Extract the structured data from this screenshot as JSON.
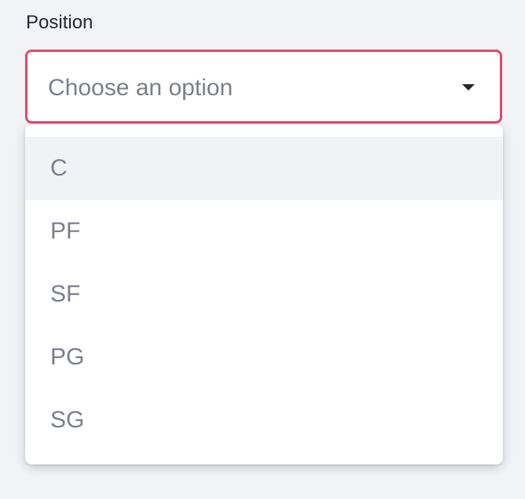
{
  "field": {
    "label": "Position",
    "placeholder": "Choose an option"
  },
  "dropdown": {
    "options": [
      {
        "label": "C",
        "highlighted": true
      },
      {
        "label": "PF",
        "highlighted": false
      },
      {
        "label": "SF",
        "highlighted": false
      },
      {
        "label": "PG",
        "highlighted": false
      },
      {
        "label": "SG",
        "highlighted": false
      }
    ]
  },
  "colors": {
    "focus_border": "#de4a6e",
    "text_muted": "#7c7e8c",
    "text_primary": "#262730",
    "highlight_bg": "#f0f2f6",
    "page_bg": "#f2f3f6"
  },
  "icons": {
    "select_arrow": "chevron-down-icon"
  }
}
